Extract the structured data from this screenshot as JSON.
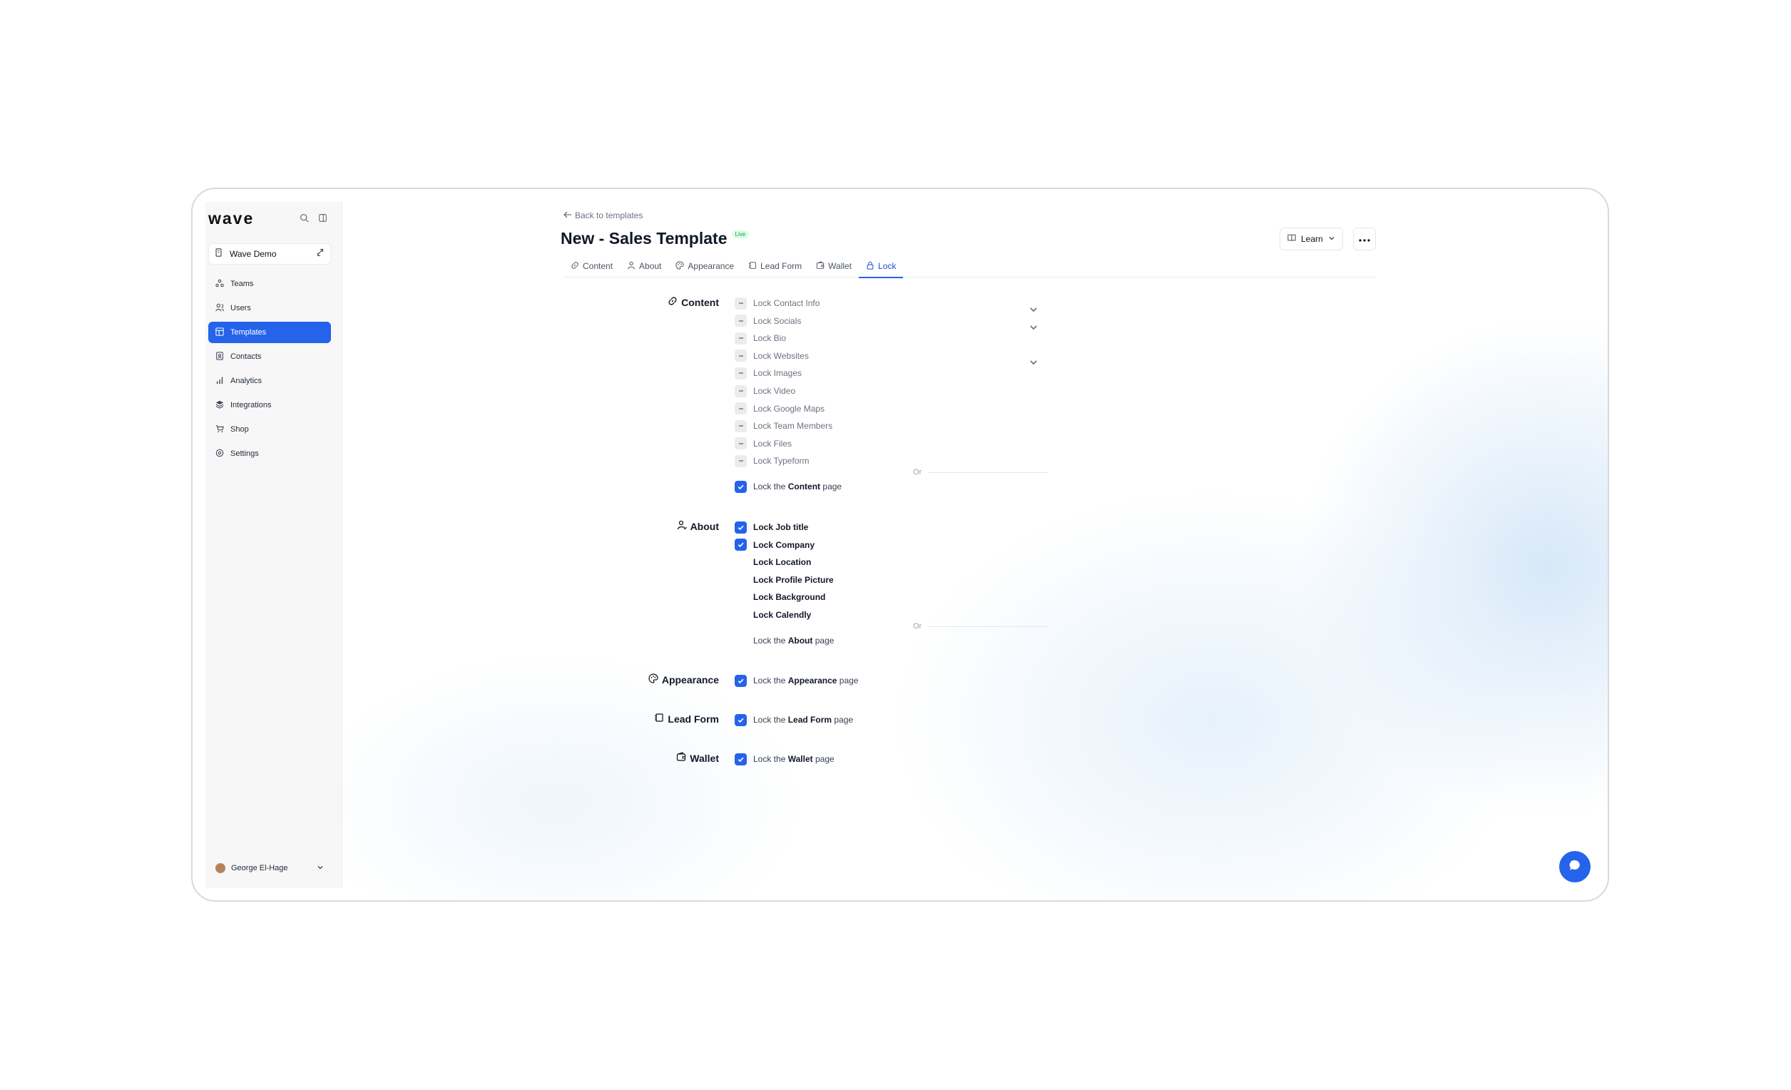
{
  "app": {
    "logo": "wave",
    "workspace": "Wave Demo"
  },
  "sidebar": {
    "items": [
      {
        "label": "Teams",
        "icon": "teams-icon"
      },
      {
        "label": "Users",
        "icon": "users-icon"
      },
      {
        "label": "Templates",
        "icon": "templates-icon",
        "active": true
      },
      {
        "label": "Contacts",
        "icon": "contacts-icon"
      },
      {
        "label": "Analytics",
        "icon": "analytics-icon"
      },
      {
        "label": "Integrations",
        "icon": "integrations-icon"
      },
      {
        "label": "Shop",
        "icon": "shop-icon"
      },
      {
        "label": "Settings",
        "icon": "settings-icon"
      }
    ],
    "user": {
      "name": "George El-Hage"
    }
  },
  "header": {
    "back_label": "Back to templates",
    "title": "New - Sales Template",
    "badge": "Live",
    "learn_label": "Learn"
  },
  "tabs": [
    {
      "label": "Content",
      "icon": "link-icon"
    },
    {
      "label": "About",
      "icon": "person-icon"
    },
    {
      "label": "Appearance",
      "icon": "palette-icon"
    },
    {
      "label": "Lead Form",
      "icon": "lead-form-icon"
    },
    {
      "label": "Wallet",
      "icon": "wallet-icon"
    },
    {
      "label": "Lock",
      "icon": "lock-icon",
      "active": true
    }
  ],
  "sections": {
    "content": {
      "label": "Content",
      "items": [
        {
          "label": "Lock Contact Info",
          "state": "indeterminate",
          "expandable": true
        },
        {
          "label": "Lock Socials",
          "state": "indeterminate",
          "expandable": true
        },
        {
          "label": "Lock Bio",
          "state": "indeterminate"
        },
        {
          "label": "Lock Websites",
          "state": "indeterminate",
          "expandable": true
        },
        {
          "label": "Lock Images",
          "state": "indeterminate"
        },
        {
          "label": "Lock Video",
          "state": "indeterminate"
        },
        {
          "label": "Lock Google Maps",
          "state": "indeterminate"
        },
        {
          "label": "Lock Team Members",
          "state": "indeterminate"
        },
        {
          "label": "Lock Files",
          "state": "indeterminate"
        },
        {
          "label": "Lock Typeform",
          "state": "indeterminate"
        }
      ],
      "or_label": "Or",
      "page_lock": {
        "prefix": "Lock the",
        "name": "Content",
        "suffix": "page",
        "checked": true
      }
    },
    "about": {
      "label": "About",
      "items": [
        {
          "label": "Lock Job title",
          "state": "checked"
        },
        {
          "label": "Lock Company",
          "state": "checked"
        },
        {
          "label": "Lock Location",
          "state": "unchecked"
        },
        {
          "label": "Lock Profile Picture",
          "state": "unchecked"
        },
        {
          "label": "Lock Background",
          "state": "unchecked"
        },
        {
          "label": "Lock Calendly",
          "state": "unchecked"
        }
      ],
      "or_label": "Or",
      "page_lock": {
        "prefix": "Lock the",
        "name": "About",
        "suffix": "page",
        "checked": false
      }
    },
    "appearance": {
      "label": "Appearance",
      "page_lock": {
        "prefix": "Lock the",
        "name": "Appearance",
        "suffix": "page",
        "checked": true
      }
    },
    "lead_form": {
      "label": "Lead Form",
      "page_lock": {
        "prefix": "Lock the",
        "name": "Lead Form",
        "suffix": "page",
        "checked": true
      }
    },
    "wallet": {
      "label": "Wallet",
      "page_lock": {
        "prefix": "Lock the",
        "name": "Wallet",
        "suffix": "page",
        "checked": true
      }
    }
  },
  "colors": {
    "accent": "#2563eb",
    "live_badge": "#16a34a"
  }
}
